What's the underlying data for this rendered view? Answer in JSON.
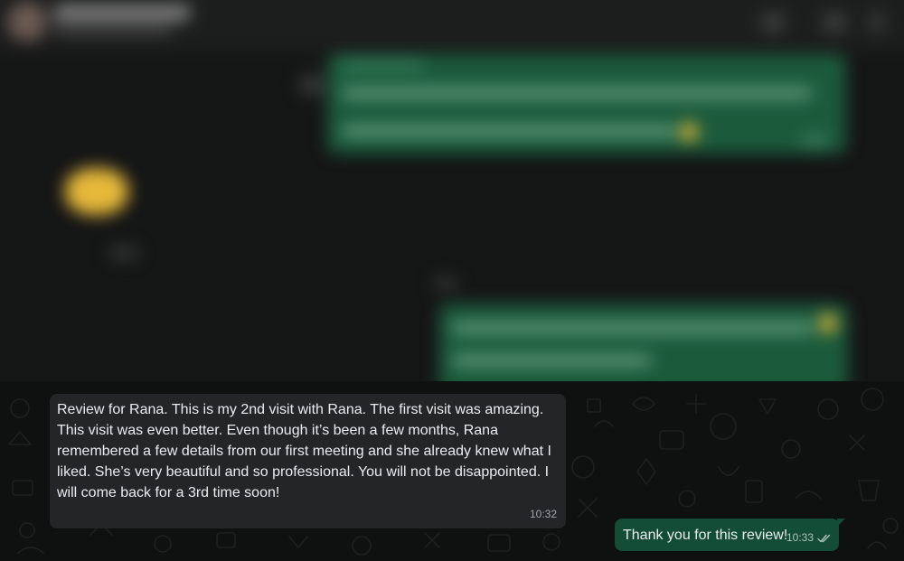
{
  "messages": [
    {
      "direction": "incoming",
      "text": "Review for Rana. This is my 2nd visit with Rana. The first visit was amazing. This visit was even better. Even though it’s been a few months, Rana remembered a few details from our first meeting and she already knew what I liked. She’s very beautiful and so professional. You will not be disappointed. I will come back for a 3rd time soon!",
      "time": "10:32"
    },
    {
      "direction": "outgoing",
      "text": "Thank you for this review!",
      "time": "10:33",
      "status_icon": "double-check-icon"
    }
  ],
  "colors": {
    "incoming_bubble": "#232526",
    "outgoing_bubble": "#144d37",
    "background": "#0f1010",
    "text": "#e9edef"
  }
}
